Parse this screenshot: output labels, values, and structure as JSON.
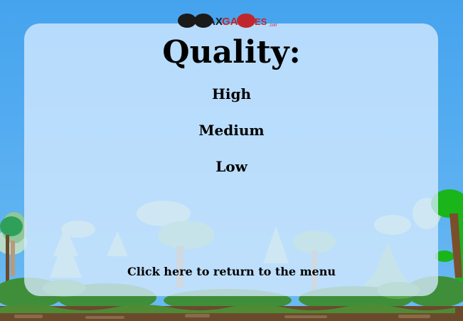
{
  "logo": {
    "text_left": "MAX",
    "text_right": "GAMES",
    "suffix": ".com"
  },
  "title": "Quality:",
  "options": [
    {
      "label": "High"
    },
    {
      "label": "Medium"
    },
    {
      "label": "Low"
    }
  ],
  "return_label": "Click here to return to the menu",
  "colors": {
    "sky": "#4aa6ee",
    "panel": "#d6ebff",
    "foliage_light": "#b6dcc4",
    "foliage_dark": "#3f8f3a",
    "bright_leaf": "#18b51a",
    "ground": "#6b4a2c",
    "logo_red": "#c0272d"
  }
}
